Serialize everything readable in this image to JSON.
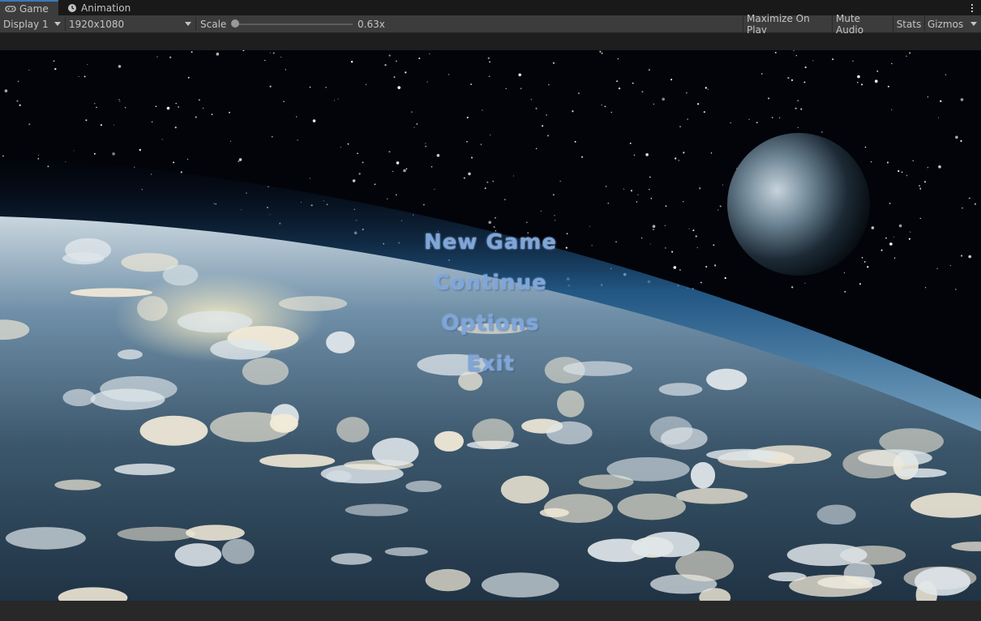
{
  "tabs": [
    {
      "label": "Game",
      "icon": "gamepad-icon",
      "active": true
    },
    {
      "label": "Animation",
      "icon": "clock-icon",
      "active": false
    }
  ],
  "toolbar": {
    "display": "Display 1",
    "resolution": "1920x1080",
    "scale_label": "Scale",
    "scale_value": "0.63x",
    "maximize_on_play": "Maximize On Play",
    "mute_audio": "Mute Audio",
    "stats": "Stats",
    "gizmos": "Gizmos"
  },
  "game_menu": {
    "items": [
      "New Game",
      "Continue",
      "Options",
      "Exit"
    ],
    "color": "#7fa6d8"
  },
  "colors": {
    "tab_accent": "#3a79bb",
    "toolbar_bg": "#3c3c3c",
    "tabbar_bg": "#191919"
  }
}
